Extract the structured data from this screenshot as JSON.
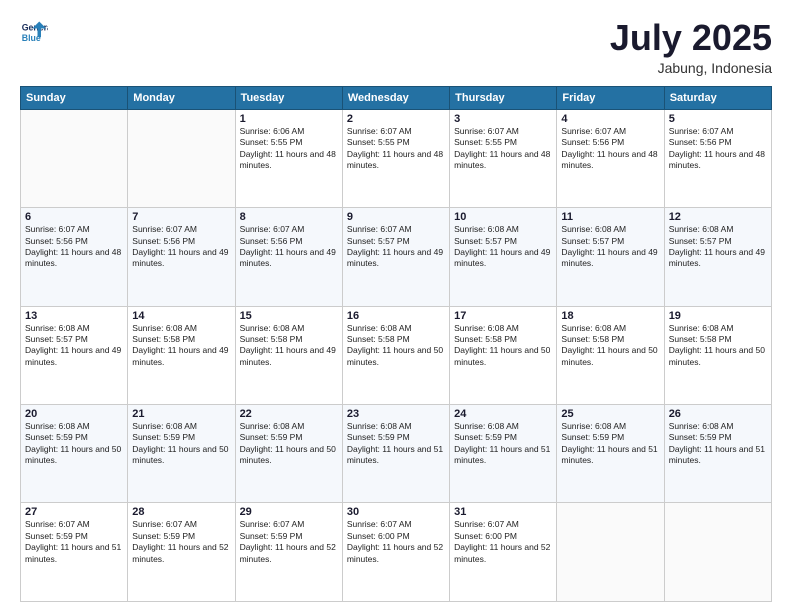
{
  "header": {
    "logo_line1": "General",
    "logo_line2": "Blue",
    "month": "July 2025",
    "location": "Jabung, Indonesia"
  },
  "weekdays": [
    "Sunday",
    "Monday",
    "Tuesday",
    "Wednesday",
    "Thursday",
    "Friday",
    "Saturday"
  ],
  "weeks": [
    [
      {
        "day": "",
        "info": ""
      },
      {
        "day": "",
        "info": ""
      },
      {
        "day": "1",
        "info": "Sunrise: 6:06 AM\nSunset: 5:55 PM\nDaylight: 11 hours and 48 minutes."
      },
      {
        "day": "2",
        "info": "Sunrise: 6:07 AM\nSunset: 5:55 PM\nDaylight: 11 hours and 48 minutes."
      },
      {
        "day": "3",
        "info": "Sunrise: 6:07 AM\nSunset: 5:55 PM\nDaylight: 11 hours and 48 minutes."
      },
      {
        "day": "4",
        "info": "Sunrise: 6:07 AM\nSunset: 5:56 PM\nDaylight: 11 hours and 48 minutes."
      },
      {
        "day": "5",
        "info": "Sunrise: 6:07 AM\nSunset: 5:56 PM\nDaylight: 11 hours and 48 minutes."
      }
    ],
    [
      {
        "day": "6",
        "info": "Sunrise: 6:07 AM\nSunset: 5:56 PM\nDaylight: 11 hours and 48 minutes."
      },
      {
        "day": "7",
        "info": "Sunrise: 6:07 AM\nSunset: 5:56 PM\nDaylight: 11 hours and 49 minutes."
      },
      {
        "day": "8",
        "info": "Sunrise: 6:07 AM\nSunset: 5:56 PM\nDaylight: 11 hours and 49 minutes."
      },
      {
        "day": "9",
        "info": "Sunrise: 6:07 AM\nSunset: 5:57 PM\nDaylight: 11 hours and 49 minutes."
      },
      {
        "day": "10",
        "info": "Sunrise: 6:08 AM\nSunset: 5:57 PM\nDaylight: 11 hours and 49 minutes."
      },
      {
        "day": "11",
        "info": "Sunrise: 6:08 AM\nSunset: 5:57 PM\nDaylight: 11 hours and 49 minutes."
      },
      {
        "day": "12",
        "info": "Sunrise: 6:08 AM\nSunset: 5:57 PM\nDaylight: 11 hours and 49 minutes."
      }
    ],
    [
      {
        "day": "13",
        "info": "Sunrise: 6:08 AM\nSunset: 5:57 PM\nDaylight: 11 hours and 49 minutes."
      },
      {
        "day": "14",
        "info": "Sunrise: 6:08 AM\nSunset: 5:58 PM\nDaylight: 11 hours and 49 minutes."
      },
      {
        "day": "15",
        "info": "Sunrise: 6:08 AM\nSunset: 5:58 PM\nDaylight: 11 hours and 49 minutes."
      },
      {
        "day": "16",
        "info": "Sunrise: 6:08 AM\nSunset: 5:58 PM\nDaylight: 11 hours and 50 minutes."
      },
      {
        "day": "17",
        "info": "Sunrise: 6:08 AM\nSunset: 5:58 PM\nDaylight: 11 hours and 50 minutes."
      },
      {
        "day": "18",
        "info": "Sunrise: 6:08 AM\nSunset: 5:58 PM\nDaylight: 11 hours and 50 minutes."
      },
      {
        "day": "19",
        "info": "Sunrise: 6:08 AM\nSunset: 5:58 PM\nDaylight: 11 hours and 50 minutes."
      }
    ],
    [
      {
        "day": "20",
        "info": "Sunrise: 6:08 AM\nSunset: 5:59 PM\nDaylight: 11 hours and 50 minutes."
      },
      {
        "day": "21",
        "info": "Sunrise: 6:08 AM\nSunset: 5:59 PM\nDaylight: 11 hours and 50 minutes."
      },
      {
        "day": "22",
        "info": "Sunrise: 6:08 AM\nSunset: 5:59 PM\nDaylight: 11 hours and 50 minutes."
      },
      {
        "day": "23",
        "info": "Sunrise: 6:08 AM\nSunset: 5:59 PM\nDaylight: 11 hours and 51 minutes."
      },
      {
        "day": "24",
        "info": "Sunrise: 6:08 AM\nSunset: 5:59 PM\nDaylight: 11 hours and 51 minutes."
      },
      {
        "day": "25",
        "info": "Sunrise: 6:08 AM\nSunset: 5:59 PM\nDaylight: 11 hours and 51 minutes."
      },
      {
        "day": "26",
        "info": "Sunrise: 6:08 AM\nSunset: 5:59 PM\nDaylight: 11 hours and 51 minutes."
      }
    ],
    [
      {
        "day": "27",
        "info": "Sunrise: 6:07 AM\nSunset: 5:59 PM\nDaylight: 11 hours and 51 minutes."
      },
      {
        "day": "28",
        "info": "Sunrise: 6:07 AM\nSunset: 5:59 PM\nDaylight: 11 hours and 52 minutes."
      },
      {
        "day": "29",
        "info": "Sunrise: 6:07 AM\nSunset: 5:59 PM\nDaylight: 11 hours and 52 minutes."
      },
      {
        "day": "30",
        "info": "Sunrise: 6:07 AM\nSunset: 6:00 PM\nDaylight: 11 hours and 52 minutes."
      },
      {
        "day": "31",
        "info": "Sunrise: 6:07 AM\nSunset: 6:00 PM\nDaylight: 11 hours and 52 minutes."
      },
      {
        "day": "",
        "info": ""
      },
      {
        "day": "",
        "info": ""
      }
    ]
  ]
}
